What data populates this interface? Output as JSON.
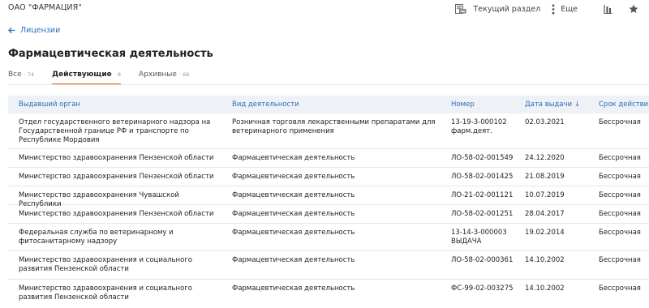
{
  "header": {
    "company": "ОАО \"ФАРМАЦИЯ\"",
    "current_section_label": "Текущий раздел",
    "more_label": "Еще",
    "icons": {
      "section": "document-section-icon",
      "more": "vertical-dots-icon",
      "chart": "bar-chart-icon",
      "star": "star-icon"
    }
  },
  "breadcrumb": {
    "back_label": "Лицензии",
    "icon": "arrow-left-icon"
  },
  "page": {
    "title": "Фармацевтическая деятельность"
  },
  "tabs": [
    {
      "label": "Все",
      "count": "74",
      "active": false
    },
    {
      "label": "Действующие",
      "count": "8",
      "active": true
    },
    {
      "label": "Архивные",
      "count": "66",
      "active": false
    }
  ],
  "table": {
    "columns": [
      "Выдавший орган",
      "Вид деятельности",
      "Номер",
      "Дата выдачи ↓",
      "Срок действия"
    ],
    "rows": [
      [
        "Отдел государственного ветеринарного надзора на Государственной границе РФ и транспорте по Республике Мордовия",
        "Розничная торговля лекарственными препаратами для ветеринарного применения",
        "13-19-3-000102 фарм.деят.",
        "02.03.2021",
        "Бессрочная"
      ],
      [
        "Министерство здравоохранения Пензенской области",
        "Фармацевтическая деятельность",
        "ЛО-58-02-001549",
        "24.12.2020",
        "Бессрочная"
      ],
      [
        "Министерство здравоохранения Пензенской области",
        "Фармацевтическая деятельность",
        "ЛО-58-02-001425",
        "21.08.2019",
        "Бессрочная"
      ],
      [
        "Министерство здравоохранения Чувашской Республики",
        "Фармацевтическая деятельность",
        "ЛО-21-02-001121",
        "10.07.2019",
        "Бессрочная"
      ],
      [
        "Министерство здравоохранения Пензенской области",
        "Фармацевтическая деятельность",
        "ЛО-58-02-001251",
        "28.04.2017",
        "Бессрочная"
      ],
      [
        "Федеральная служба по ветеринарному и фитосанитарному надзору",
        "Фармацевтическая деятельность",
        "13-14-3-000003 ВЫДАЧА",
        "19.02.2014",
        "Бессрочная"
      ],
      [
        "Министерство здравоохранения и социального развития Пензенской области",
        "Фармацевтическая деятельность",
        "ЛО-58-02-000361",
        "14.10.2002",
        "Бессрочная"
      ],
      [
        "Министерство здравоохранения и социального развития Пензенской области",
        "Фармацевтическая деятельность",
        "ФС-99-02-003275",
        "14.10.2002",
        "Бессрочная"
      ]
    ]
  }
}
